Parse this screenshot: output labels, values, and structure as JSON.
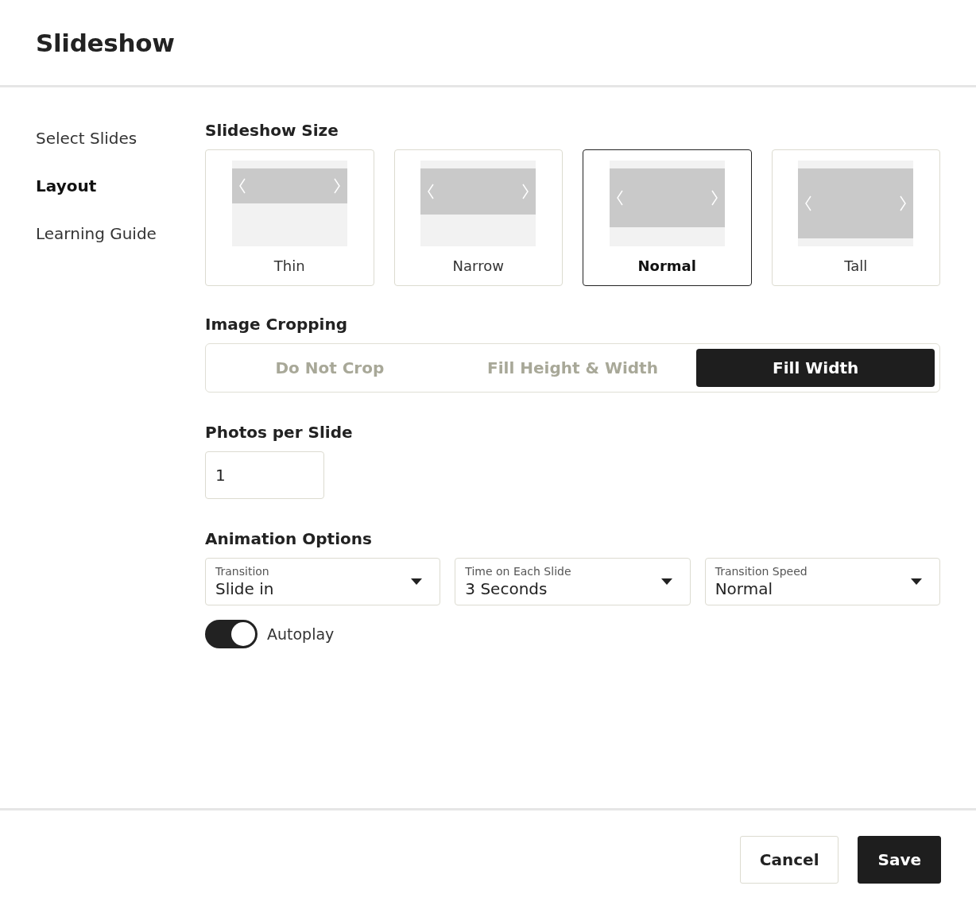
{
  "dialog": {
    "title": "Slideshow"
  },
  "sidebar": {
    "items": [
      {
        "label": "Select Slides",
        "selected": false
      },
      {
        "label": "Layout",
        "selected": true
      },
      {
        "label": "Learning Guide",
        "selected": false
      }
    ]
  },
  "slideshow_size": {
    "label": "Slideshow Size",
    "options": [
      {
        "label": "Thin",
        "selected": false
      },
      {
        "label": "Narrow",
        "selected": false
      },
      {
        "label": "Normal",
        "selected": true
      },
      {
        "label": "Tall",
        "selected": false
      }
    ]
  },
  "image_cropping": {
    "label": "Image Cropping",
    "options": [
      {
        "label": "Do Not Crop",
        "selected": false
      },
      {
        "label": "Fill Height & Width",
        "selected": false
      },
      {
        "label": "Fill Width",
        "selected": true
      }
    ]
  },
  "photos_per_slide": {
    "label": "Photos per Slide",
    "value": "1"
  },
  "animation_options": {
    "label": "Animation Options",
    "selects": [
      {
        "label": "Transition",
        "value": "Slide in"
      },
      {
        "label": "Time on Each Slide",
        "value": "3 Seconds"
      },
      {
        "label": "Transition Speed",
        "value": "Normal"
      }
    ],
    "autoplay": {
      "label": "Autoplay",
      "on": true
    }
  },
  "buttons": [
    {
      "label": "Cancel",
      "kind": "secondary"
    },
    {
      "label": "Save",
      "kind": "primary"
    }
  ]
}
